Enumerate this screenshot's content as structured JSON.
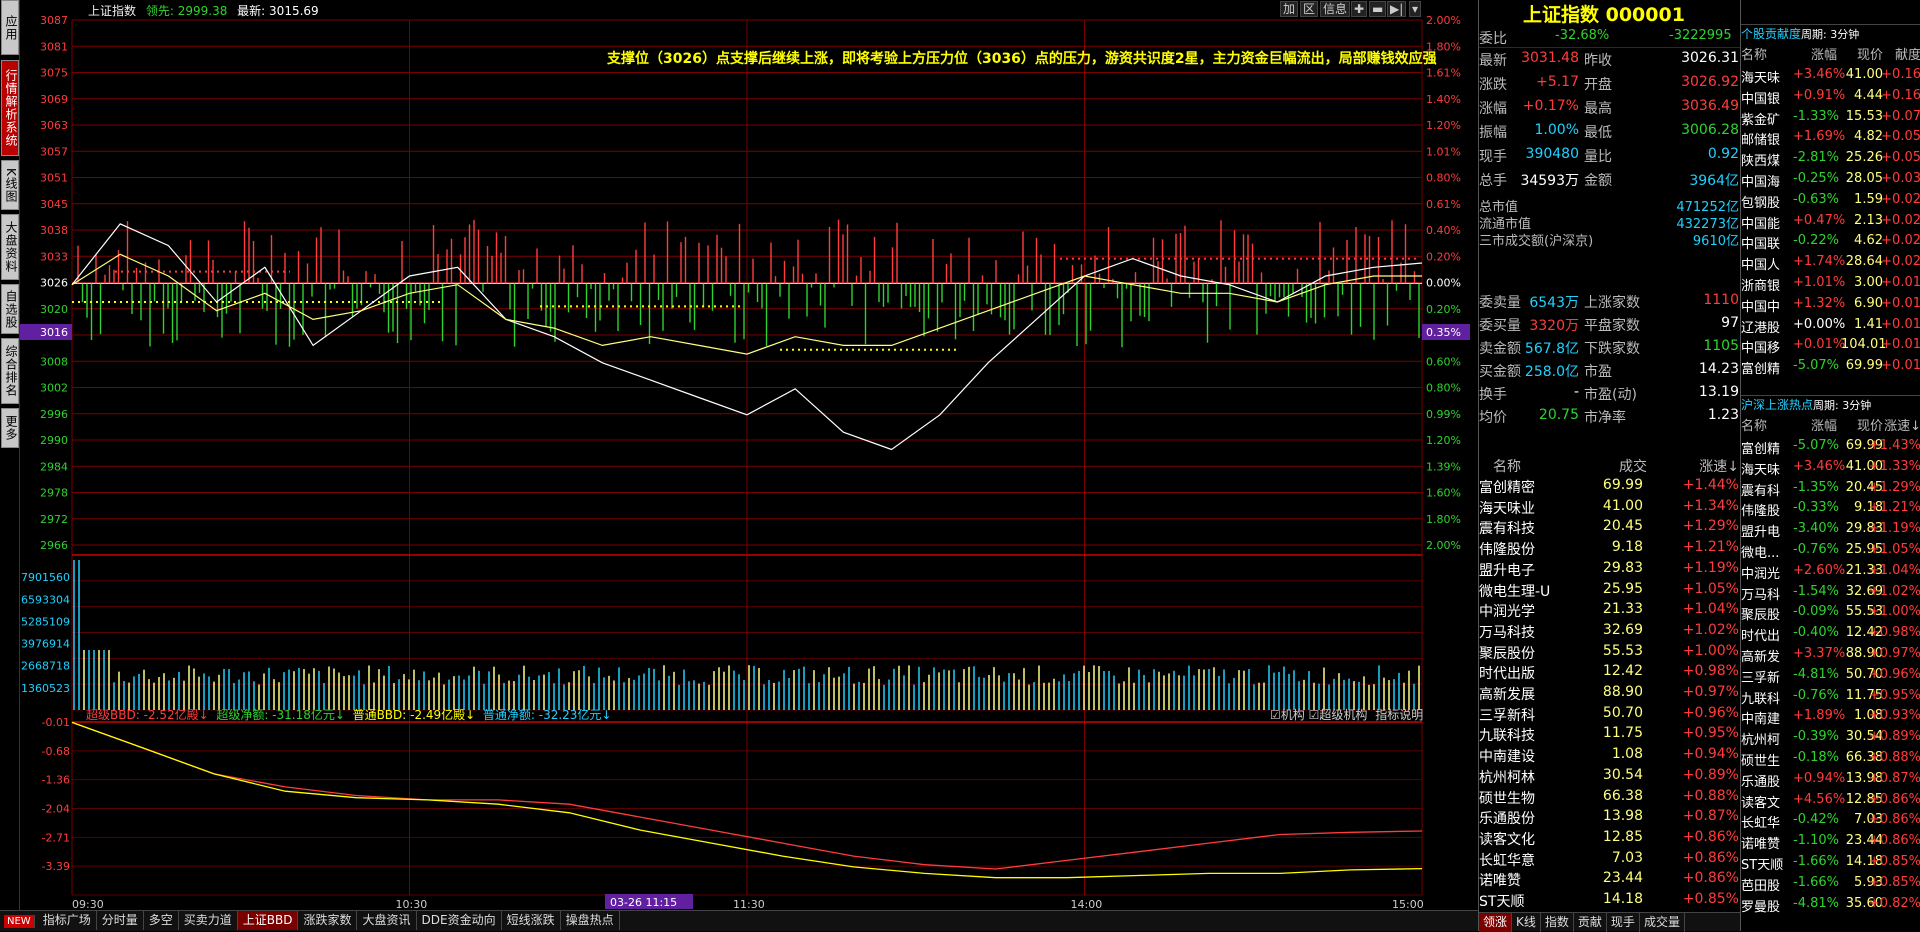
{
  "left_tabs": [
    "应用",
    "行情解析系统",
    "K线图",
    "大盘资料",
    "自选股",
    "综合排名",
    "更多"
  ],
  "chart": {
    "index_name": "上证指数",
    "lead_label": "领先:",
    "lead_value": "2999.38",
    "latest_label": "最新:",
    "latest_value": "3015.69",
    "buttons": [
      "加",
      "区",
      "信息"
    ],
    "annotation": "支撑位（3026）点支撑后继续上涨，即将考验上方压力位（3036）点的压力，游资共识度2星，主力资金巨幅流出，局部赚钱效应强",
    "price_ticks": [
      "3087",
      "3081",
      "3075",
      "3069",
      "3063",
      "3057",
      "3051",
      "3045",
      "3038",
      "3033",
      "3026",
      "3020",
      "3016",
      "3008",
      "3002",
      "2996",
      "2990",
      "2984",
      "2978",
      "2972",
      "2966"
    ],
    "pct_ticks": [
      "2.00%",
      "1.80%",
      "1.61%",
      "1.40%",
      "1.20%",
      "1.01%",
      "0.80%",
      "0.61%",
      "0.40%",
      "0.20%",
      "0.00%",
      "0.20%",
      "0.35%",
      "0.60%",
      "0.80%",
      "0.99%",
      "1.20%",
      "1.39%",
      "1.60%",
      "1.80%",
      "2.00%"
    ],
    "crosshair_price": "3016",
    "crosshair_pct": "0.35%",
    "vol_ticks": [
      "7901560",
      "6593304",
      "5285109",
      "3976914",
      "2668718",
      "1360523"
    ],
    "bbd_ticks": [
      "-0.01",
      "-0.68",
      "-1.36",
      "-2.04",
      "-2.71",
      "-3.39"
    ],
    "time_ticks": [
      "09:30",
      "10:30",
      "11:30",
      "14:00",
      "15:00"
    ],
    "cursor_time": "03-26 11:15",
    "bbd": [
      {
        "label": "超级BBD: -2.52亿殿↓",
        "color": "#ff3c3c"
      },
      {
        "label": "超级净额: -31.18亿元↓",
        "color": "#2fd32f"
      },
      {
        "label": "普通BBD: -2.49亿殿↓",
        "color": "#ff0"
      },
      {
        "label": "普通净额: -32.23亿元↓",
        "color": "#20d0ff"
      }
    ],
    "bbd_right": [
      "机构",
      "超级机构",
      "指标说明"
    ]
  },
  "bottom_tabs": [
    "指标广场",
    "分时量",
    "多空",
    "买卖力道",
    "上证BBD",
    "涨跌家数",
    "大盘资讯",
    "DDE资金动向",
    "短线涨跌",
    "操盘热点"
  ],
  "bottom_new": "NEW",
  "quote": {
    "title": "上证指数 000001",
    "weibi_label": "委比",
    "weibi": "-32.68%",
    "weicha": "-3222995",
    "rows": [
      {
        "l1": "最新",
        "v1": "3031.48",
        "c1": "red",
        "l2": "昨收",
        "v2": "3026.31",
        "c2": "white"
      },
      {
        "l1": "涨跌",
        "v1": "+5.17",
        "c1": "red",
        "l2": "开盘",
        "v2": "3026.92",
        "c2": "red"
      },
      {
        "l1": "涨幅",
        "v1": "+0.17%",
        "c1": "red",
        "l2": "最高",
        "v2": "3036.49",
        "c2": "red"
      },
      {
        "l1": "振幅",
        "v1": "1.00%",
        "c1": "cyan",
        "l2": "最低",
        "v2": "3006.28",
        "c2": "green"
      },
      {
        "l1": "现手",
        "v1": "390480",
        "c1": "cyan",
        "l2": "量比",
        "v2": "0.92",
        "c2": "cyan"
      },
      {
        "l1": "总手",
        "v1": "34593万",
        "c1": "white",
        "l2": "金额",
        "v2": "3964亿",
        "c2": "cyan"
      }
    ],
    "caps": [
      {
        "l": "总市值",
        "v": "471252亿"
      },
      {
        "l": "流通市值",
        "v": "432273亿"
      },
      {
        "l": "三市成交额(沪深京)",
        "v": "9610亿"
      }
    ],
    "rows2": [
      {
        "l1": "委卖量",
        "v1": "6543万",
        "c1": "cyan",
        "l2": "上涨家数",
        "v2": "1110",
        "c2": "red"
      },
      {
        "l1": "委买量",
        "v1": "3320万",
        "c1": "red",
        "l2": "平盘家数",
        "v2": "97",
        "c2": "white"
      },
      {
        "l1": "卖金额",
        "v1": "567.8亿",
        "c1": "cyan",
        "l2": "下跌家数",
        "v2": "1105",
        "c2": "green"
      },
      {
        "l1": "买金额",
        "v1": "258.0亿",
        "c1": "cyan",
        "l2": "市盈",
        "v2": "14.23",
        "c2": "white"
      },
      {
        "l1": "换手",
        "v1": "-",
        "c1": "white",
        "l2": "市盈(动)",
        "v2": "13.19",
        "c2": "white"
      },
      {
        "l1": "均价",
        "v1": "20.75",
        "c1": "green",
        "l2": "市净率",
        "v2": "1.23",
        "c2": "white"
      }
    ],
    "list_headers": [
      "名称",
      "成交",
      "涨速↓"
    ],
    "stocks": [
      {
        "name": "富创精密",
        "price": "69.99",
        "speed": "+1.44%"
      },
      {
        "name": "海天味业",
        "price": "41.00",
        "speed": "+1.34%"
      },
      {
        "name": "震有科技",
        "price": "20.45",
        "speed": "+1.29%"
      },
      {
        "name": "伟隆股份",
        "price": "9.18",
        "speed": "+1.21%"
      },
      {
        "name": "盟升电子",
        "price": "29.83",
        "speed": "+1.19%"
      },
      {
        "name": "微电生理-U",
        "price": "25.95",
        "speed": "+1.05%"
      },
      {
        "name": "中润光学",
        "price": "21.33",
        "speed": "+1.04%"
      },
      {
        "name": "万马科技",
        "price": "32.69",
        "speed": "+1.02%"
      },
      {
        "name": "聚辰股份",
        "price": "55.53",
        "speed": "+1.00%"
      },
      {
        "name": "时代出版",
        "price": "12.42",
        "speed": "+0.98%"
      },
      {
        "name": "高新发展",
        "price": "88.90",
        "speed": "+0.97%"
      },
      {
        "name": "三孚新科",
        "price": "50.70",
        "speed": "+0.96%"
      },
      {
        "name": "九联科技",
        "price": "11.75",
        "speed": "+0.95%"
      },
      {
        "name": "中南建设",
        "price": "1.08",
        "speed": "+0.94%"
      },
      {
        "name": "杭州柯林",
        "price": "30.54",
        "speed": "+0.89%"
      },
      {
        "name": "硕世生物",
        "price": "66.38",
        "speed": "+0.88%"
      },
      {
        "name": "乐通股份",
        "price": "13.98",
        "speed": "+0.87%"
      },
      {
        "name": "读客文化",
        "price": "12.85",
        "speed": "+0.86%"
      },
      {
        "name": "长虹华意",
        "price": "7.03",
        "speed": "+0.86%"
      },
      {
        "name": "诺唯赞",
        "price": "23.44",
        "speed": "+0.86%"
      },
      {
        "name": "ST天顺",
        "price": "14.18",
        "speed": "+0.85%"
      }
    ],
    "bottom_tabs": [
      "领涨",
      "K线",
      "指数",
      "贡献",
      "现手",
      "成交量"
    ]
  },
  "contrib": {
    "title": "个股贡献度",
    "period": "周期: 3分钟",
    "headers": [
      "名称",
      "涨幅",
      "现价",
      "献度"
    ],
    "rows": [
      {
        "name": "海天味",
        "pct": "+3.46%",
        "price": "41.00",
        "contrib": "+0.16",
        "color": "red"
      },
      {
        "name": "中国银",
        "pct": "+0.91%",
        "price": "4.44",
        "contrib": "+0.16",
        "color": "red"
      },
      {
        "name": "紫金矿",
        "pct": "-1.33%",
        "price": "15.53",
        "contrib": "+0.07",
        "color": "green"
      },
      {
        "name": "邮储银",
        "pct": "+1.69%",
        "price": "4.82",
        "contrib": "+0.05",
        "color": "red"
      },
      {
        "name": "陕西煤",
        "pct": "-2.81%",
        "price": "25.26",
        "contrib": "+0.05",
        "color": "green"
      },
      {
        "name": "中国海",
        "pct": "-0.25%",
        "price": "28.05",
        "contrib": "+0.03",
        "color": "green"
      },
      {
        "name": "包钢股",
        "pct": "-0.63%",
        "price": "1.59",
        "contrib": "+0.02",
        "color": "green"
      },
      {
        "name": "中国能",
        "pct": "+0.47%",
        "price": "2.13",
        "contrib": "+0.02",
        "color": "red"
      },
      {
        "name": "中国联",
        "pct": "-0.22%",
        "price": "4.62",
        "contrib": "+0.02",
        "color": "green"
      },
      {
        "name": "中国人",
        "pct": "+1.74%",
        "price": "28.64",
        "contrib": "+0.02",
        "color": "red"
      },
      {
        "name": "浙商银",
        "pct": "+1.01%",
        "price": "3.00",
        "contrib": "+0.01",
        "color": "red"
      },
      {
        "name": "中国中",
        "pct": "+1.32%",
        "price": "6.90",
        "contrib": "+0.01",
        "color": "red"
      },
      {
        "name": "辽港股",
        "pct": "+0.00%",
        "price": "1.41",
        "contrib": "+0.01",
        "color": "white"
      },
      {
        "name": "中国移",
        "pct": "+0.01%",
        "price": "104.01",
        "contrib": "+0.01",
        "color": "red"
      },
      {
        "name": "富创精",
        "pct": "-5.07%",
        "price": "69.99",
        "contrib": "+0.01",
        "color": "green"
      }
    ]
  },
  "hot": {
    "title": "沪深上涨热点",
    "period": "周期: 3分钟",
    "headers": [
      "名称",
      "涨幅",
      "现价",
      "涨速↓"
    ],
    "rows": [
      {
        "name": "富创精",
        "pct": "-5.07%",
        "price": "69.99",
        "speed": "+1.43%",
        "color": "green"
      },
      {
        "name": "海天味",
        "pct": "+3.46%",
        "price": "41.00",
        "speed": "+1.33%",
        "color": "red"
      },
      {
        "name": "震有科",
        "pct": "-1.35%",
        "price": "20.45",
        "speed": "+1.29%",
        "color": "green"
      },
      {
        "name": "伟隆股",
        "pct": "-0.33%",
        "price": "9.18",
        "speed": "+1.21%",
        "color": "green"
      },
      {
        "name": "盟升电",
        "pct": "-3.40%",
        "price": "29.83",
        "speed": "+1.19%",
        "color": "green"
      },
      {
        "name": "微电...",
        "pct": "-0.76%",
        "price": "25.95",
        "speed": "+1.05%",
        "color": "green"
      },
      {
        "name": "中润光",
        "pct": "+2.60%",
        "price": "21.33",
        "speed": "+1.04%",
        "color": "red"
      },
      {
        "name": "万马科",
        "pct": "-1.54%",
        "price": "32.69",
        "speed": "+1.02%",
        "color": "green"
      },
      {
        "name": "聚辰股",
        "pct": "-0.09%",
        "price": "55.53",
        "speed": "+1.00%",
        "color": "green"
      },
      {
        "name": "时代出",
        "pct": "-0.40%",
        "price": "12.42",
        "speed": "+0.98%",
        "color": "green"
      },
      {
        "name": "高新发",
        "pct": "+3.37%",
        "price": "88.90",
        "speed": "+0.97%",
        "color": "red"
      },
      {
        "name": "三孚新",
        "pct": "-4.81%",
        "price": "50.70",
        "speed": "+0.96%",
        "color": "green"
      },
      {
        "name": "九联科",
        "pct": "-0.76%",
        "price": "11.75",
        "speed": "+0.95%",
        "color": "green"
      },
      {
        "name": "中南建",
        "pct": "+1.89%",
        "price": "1.08",
        "speed": "+0.93%",
        "color": "red"
      },
      {
        "name": "杭州柯",
        "pct": "-0.39%",
        "price": "30.54",
        "speed": "+0.89%",
        "color": "green"
      },
      {
        "name": "硕世生",
        "pct": "-0.18%",
        "price": "66.38",
        "speed": "+0.88%",
        "color": "green"
      },
      {
        "name": "乐通股",
        "pct": "+0.94%",
        "price": "13.98",
        "speed": "+0.87%",
        "color": "red"
      },
      {
        "name": "读客文",
        "pct": "+4.56%",
        "price": "12.85",
        "speed": "+0.86%",
        "color": "red"
      },
      {
        "name": "长虹华",
        "pct": "-0.42%",
        "price": "7.03",
        "speed": "+0.86%",
        "color": "green"
      },
      {
        "name": "诺唯赞",
        "pct": "-1.10%",
        "price": "23.44",
        "speed": "+0.86%",
        "color": "green"
      },
      {
        "name": "ST天顺",
        "pct": "-1.66%",
        "price": "14.18",
        "speed": "+0.85%",
        "color": "green"
      },
      {
        "name": "芭田股",
        "pct": "-1.66%",
        "price": "5.93",
        "speed": "+0.85%",
        "color": "green"
      },
      {
        "name": "罗曼股",
        "pct": "-4.81%",
        "price": "35.60",
        "speed": "+0.82%",
        "color": "green"
      }
    ]
  },
  "chart_data": {
    "type": "line",
    "title": "上证指数",
    "xlabel": "",
    "ylabel": "",
    "x": [
      "09:30",
      "10:30",
      "11:30",
      "14:00",
      "15:00"
    ],
    "ylim": [
      2966,
      3087
    ],
    "prev_close": 3026.31,
    "series": [
      {
        "name": "上证指数",
        "values": [
          3026,
          3040,
          3035,
          3022,
          3030,
          3012,
          3020,
          3028,
          3030,
          3018,
          3014,
          3008,
          3004,
          3000,
          2996,
          3002,
          2992,
          2988,
          2996,
          3008,
          3018,
          3028,
          3032,
          3028,
          3026,
          3022,
          3028,
          3030,
          3031
        ]
      },
      {
        "name": "均价",
        "values": [
          3026,
          3033,
          3028,
          3020,
          3024,
          3018,
          3020,
          3024,
          3026,
          3018,
          3016,
          3012,
          3014,
          3012,
          3010,
          3014,
          3012,
          3012,
          3016,
          3020,
          3024,
          3028,
          3026,
          3024,
          3024,
          3022,
          3026,
          3028,
          3028
        ]
      }
    ],
    "bbd_series": [
      {
        "name": "超级BBD",
        "values": [
          -0.01,
          -0.6,
          -1.2,
          -1.5,
          -1.7,
          -1.8,
          -1.8,
          -1.9,
          -2.2,
          -2.5,
          -2.8,
          -3.1,
          -3.3,
          -3.4,
          -3.2,
          -3.0,
          -2.8,
          -2.6,
          -2.55,
          -2.52
        ]
      },
      {
        "name": "普通BBD",
        "values": [
          -0.01,
          -0.6,
          -1.2,
          -1.6,
          -1.75,
          -1.8,
          -1.9,
          -2.1,
          -2.5,
          -2.8,
          -3.1,
          -3.35,
          -3.5,
          -3.6,
          -3.6,
          -3.55,
          -3.5,
          -3.5,
          -3.42,
          -3.39
        ]
      }
    ]
  }
}
